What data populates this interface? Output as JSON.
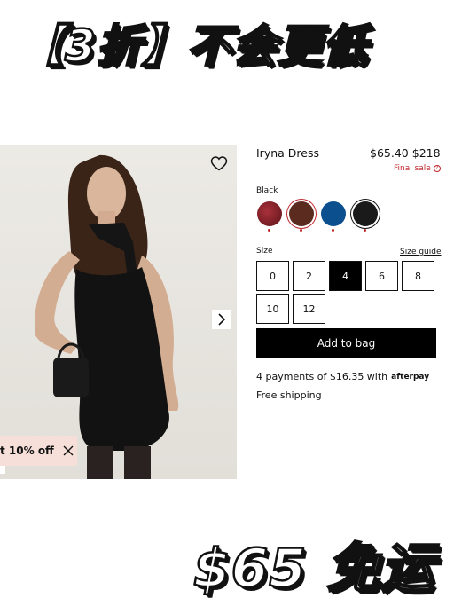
{
  "promo": {
    "top_text": "【3折】不会更低",
    "bottom_text": "$65 免运"
  },
  "product": {
    "title": "Iryna Dress",
    "price": "$65.40",
    "original_price": "$218",
    "final_sale": "Final sale",
    "color_label": "Black",
    "swatches": [
      {
        "name": "red-print",
        "color": "#7a1f24"
      },
      {
        "name": "brown",
        "color": "#5a2b1e"
      },
      {
        "name": "blue",
        "color": "#0b4f8f"
      },
      {
        "name": "black",
        "color": "#1a1a1a"
      }
    ],
    "size_label": "Size",
    "size_guide": "Size guide",
    "sizes": [
      "0",
      "2",
      "4",
      "6",
      "8",
      "10",
      "12"
    ],
    "selected_size": "4",
    "add_to_bag": "Add to bag",
    "payments_text": "4 payments of $16.35 with",
    "afterpay_label": "afterpay",
    "shipping": "Free shipping"
  },
  "discount_tab": {
    "text": "t 10% off"
  },
  "colors": {
    "accent_red": "#c0272d",
    "discount_bg": "#f6dfd9"
  }
}
